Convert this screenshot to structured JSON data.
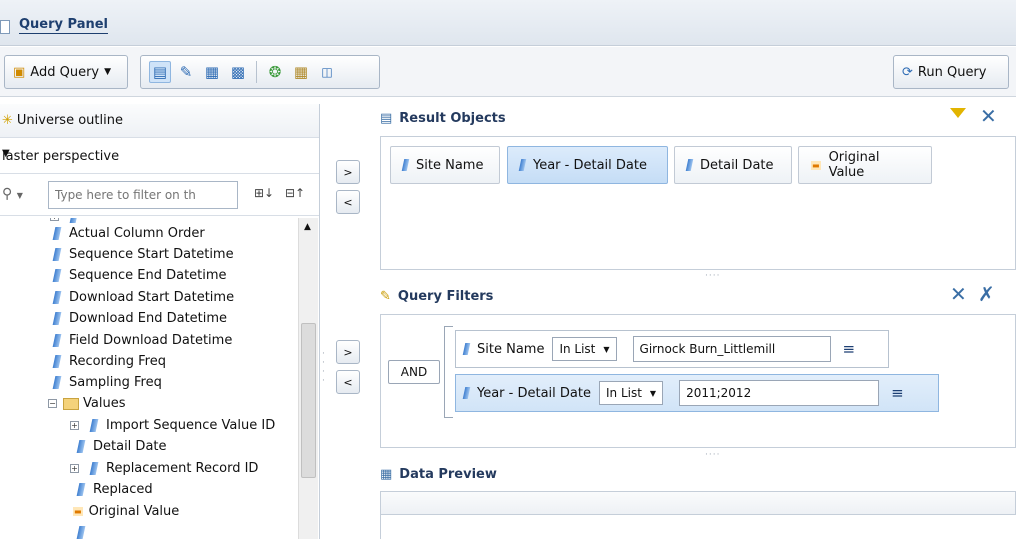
{
  "window": {
    "title": "Query Panel"
  },
  "toolbar": {
    "add_query_label": "Add Query",
    "run_query_label": "Run Query"
  },
  "left_panel": {
    "title": "Universe outline",
    "perspective": "laster perspective",
    "filter_placeholder": "Type here to filter on th",
    "tree_items": [
      {
        "label": "Actual Column Order"
      },
      {
        "label": "Sequence Start Datetime"
      },
      {
        "label": "Sequence End Datetime"
      },
      {
        "label": "Download Start Datetime"
      },
      {
        "label": "Download End Datetime"
      },
      {
        "label": "Field Download Datetime"
      },
      {
        "label": "Recording Freq"
      },
      {
        "label": "Sampling Freq"
      },
      {
        "label": "Values"
      },
      {
        "label": "Import Sequence Value ID"
      },
      {
        "label": "Detail Date"
      },
      {
        "label": "Replacement Record ID"
      },
      {
        "label": "Replaced"
      },
      {
        "label": "Original Value"
      }
    ]
  },
  "result_objects": {
    "title": "Result Objects",
    "chips": [
      {
        "label": "Site Name"
      },
      {
        "label": "Year - Detail Date"
      },
      {
        "label": "Detail Date"
      },
      {
        "label": "Original Value"
      }
    ]
  },
  "query_filters": {
    "title": "Query Filters",
    "operator": "AND",
    "filters": [
      {
        "object": "Site Name",
        "operator": "In List",
        "value": "Girnock Burn_Littlemill"
      },
      {
        "object": "Year - Detail Date",
        "operator": "In List",
        "value": "2011;2012"
      }
    ]
  },
  "data_preview": {
    "title": "Data Preview"
  },
  "buttons": {
    "move_right": ">",
    "move_left": "<"
  }
}
